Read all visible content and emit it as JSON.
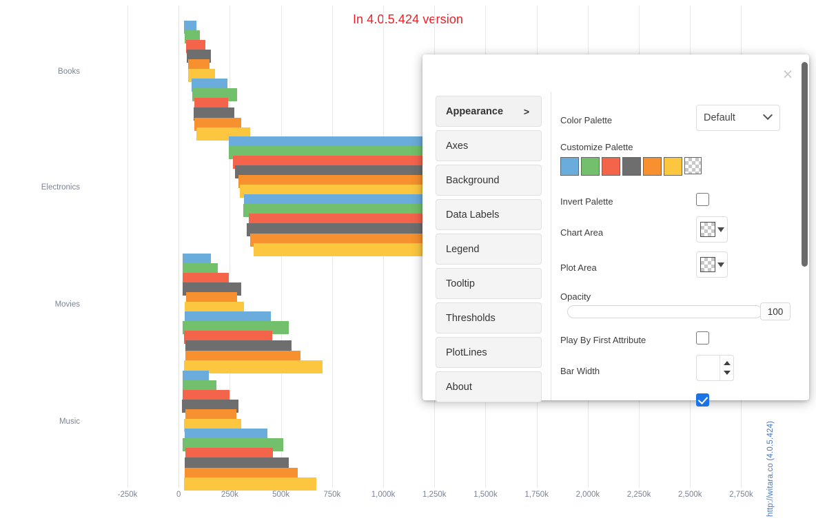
{
  "chart_title": "In 4.0.5.424 version",
  "watermark": "http://witara.co (4.0.5.424)",
  "chart_data": {
    "type": "bar",
    "orientation": "horizontal",
    "title": "In 4.0.5.424 version",
    "xlabel": "",
    "ylabel": "",
    "grid": true,
    "legend": "none",
    "xlim": [
      -250000,
      2900000
    ],
    "xticks": [
      "-250k",
      "0",
      "250k",
      "500k",
      "750k",
      "1,000k",
      "1,250k",
      "1,500k",
      "1,750k",
      "2,000k",
      "2,250k",
      "2,500k",
      "2,750k"
    ],
    "xtick_values": [
      -250000,
      0,
      250000,
      500000,
      750000,
      1000000,
      1250000,
      1500000,
      1750000,
      2000000,
      2250000,
      2500000,
      2750000
    ],
    "categories": [
      "Books",
      "Electronics",
      "Movies",
      "Music"
    ],
    "palette": [
      "#6aacdc",
      "#72c06b",
      "#f4644b",
      "#6e6e6e",
      "#f7902e",
      "#fcc63f"
    ],
    "groups": [
      {
        "category": "Books",
        "bars": [
          {
            "color_index": 0,
            "start": 27000,
            "end": 87000
          },
          {
            "color_index": 1,
            "start": 30000,
            "end": 105000
          },
          {
            "color_index": 2,
            "start": 36000,
            "end": 132000
          },
          {
            "color_index": 3,
            "start": 39000,
            "end": 159000
          },
          {
            "color_index": 4,
            "start": 45000,
            "end": 150000
          },
          {
            "color_index": 5,
            "start": 45000,
            "end": 177000
          },
          {
            "color_index": 0,
            "start": 63000,
            "end": 240000
          },
          {
            "color_index": 1,
            "start": 66000,
            "end": 285000
          },
          {
            "color_index": 2,
            "start": 78000,
            "end": 243000
          },
          {
            "color_index": 3,
            "start": 75000,
            "end": 273000
          },
          {
            "color_index": 4,
            "start": 78000,
            "end": 306000
          },
          {
            "color_index": 5,
            "start": 87000,
            "end": 351000
          }
        ]
      },
      {
        "category": "Electronics",
        "bars": [
          {
            "color_index": 0,
            "start": 246000,
            "end": 1200000
          },
          {
            "color_index": 1,
            "start": 246000,
            "end": 1335000
          },
          {
            "color_index": 2,
            "start": 264000,
            "end": 1640000
          },
          {
            "color_index": 3,
            "start": 276000,
            "end": 1640000
          },
          {
            "color_index": 4,
            "start": 294000,
            "end": 1640000
          },
          {
            "color_index": 5,
            "start": 300000,
            "end": 1640000
          },
          {
            "color_index": 0,
            "start": 318000,
            "end": 1640000
          },
          {
            "color_index": 1,
            "start": 315000,
            "end": 1640000
          },
          {
            "color_index": 2,
            "start": 342000,
            "end": 1640000
          },
          {
            "color_index": 3,
            "start": 333000,
            "end": 1640000
          },
          {
            "color_index": 4,
            "start": 351000,
            "end": 1640000
          },
          {
            "color_index": 5,
            "start": 366000,
            "end": 1640000
          }
        ]
      },
      {
        "category": "Movies",
        "bars": [
          {
            "color_index": 0,
            "start": 21000,
            "end": 159000
          },
          {
            "color_index": 1,
            "start": 18000,
            "end": 192000
          },
          {
            "color_index": 2,
            "start": 21000,
            "end": 246000
          },
          {
            "color_index": 3,
            "start": 18000,
            "end": 306000
          },
          {
            "color_index": 4,
            "start": 36000,
            "end": 285000
          },
          {
            "color_index": 5,
            "start": 30000,
            "end": 321000
          },
          {
            "color_index": 0,
            "start": 30000,
            "end": 450000
          },
          {
            "color_index": 1,
            "start": 21000,
            "end": 537000
          },
          {
            "color_index": 2,
            "start": 27000,
            "end": 456000
          },
          {
            "color_index": 3,
            "start": 33000,
            "end": 552000
          },
          {
            "color_index": 4,
            "start": 33000,
            "end": 597000
          },
          {
            "color_index": 5,
            "start": 27000,
            "end": 705000
          }
        ]
      },
      {
        "category": "Music",
        "bars": [
          {
            "color_index": 0,
            "start": 21000,
            "end": 147000
          },
          {
            "color_index": 1,
            "start": 18000,
            "end": 186000
          },
          {
            "color_index": 2,
            "start": 18000,
            "end": 249000
          },
          {
            "color_index": 3,
            "start": 15000,
            "end": 294000
          },
          {
            "color_index": 4,
            "start": 33000,
            "end": 282000
          },
          {
            "color_index": 5,
            "start": 27000,
            "end": 306000
          },
          {
            "color_index": 0,
            "start": 30000,
            "end": 435000
          },
          {
            "color_index": 1,
            "start": 18000,
            "end": 513000
          },
          {
            "color_index": 2,
            "start": 33000,
            "end": 462000
          },
          {
            "color_index": 3,
            "start": 30000,
            "end": 537000
          },
          {
            "color_index": 4,
            "start": 30000,
            "end": 582000
          },
          {
            "color_index": 5,
            "start": 27000,
            "end": 672000
          }
        ]
      }
    ]
  },
  "panel": {
    "close_label": "×",
    "nav": [
      {
        "label": "Appearance",
        "chevron": ">",
        "active": true
      },
      {
        "label": "Axes",
        "chevron": "",
        "active": false
      },
      {
        "label": "Background",
        "chevron": "",
        "active": false
      },
      {
        "label": "Data Labels",
        "chevron": "",
        "active": false
      },
      {
        "label": "Legend",
        "chevron": "",
        "active": false
      },
      {
        "label": "Tooltip",
        "chevron": "",
        "active": false
      },
      {
        "label": "Thresholds",
        "chevron": "",
        "active": false
      },
      {
        "label": "PlotLines",
        "chevron": "",
        "active": false
      },
      {
        "label": "About",
        "chevron": "",
        "active": false
      }
    ],
    "fields": {
      "color_palette_label": "Color Palette",
      "color_palette_value": "Default",
      "customize_palette_label": "Customize Palette",
      "palette_colors": [
        "#6aacdc",
        "#72c06b",
        "#f4644b",
        "#6e6e6e",
        "#f7902e",
        "#fcc63f"
      ],
      "invert_palette_label": "Invert Palette",
      "invert_palette_checked": false,
      "chart_area_label": "Chart Area",
      "plot_area_label": "Plot Area",
      "opacity_label": "Opacity",
      "opacity_value": "100",
      "play_by_first_attribute_label": "Play By First Attribute",
      "play_by_first_attribute_checked": false,
      "bar_width_label": "Bar Width",
      "bar_width_value": ""
    }
  }
}
